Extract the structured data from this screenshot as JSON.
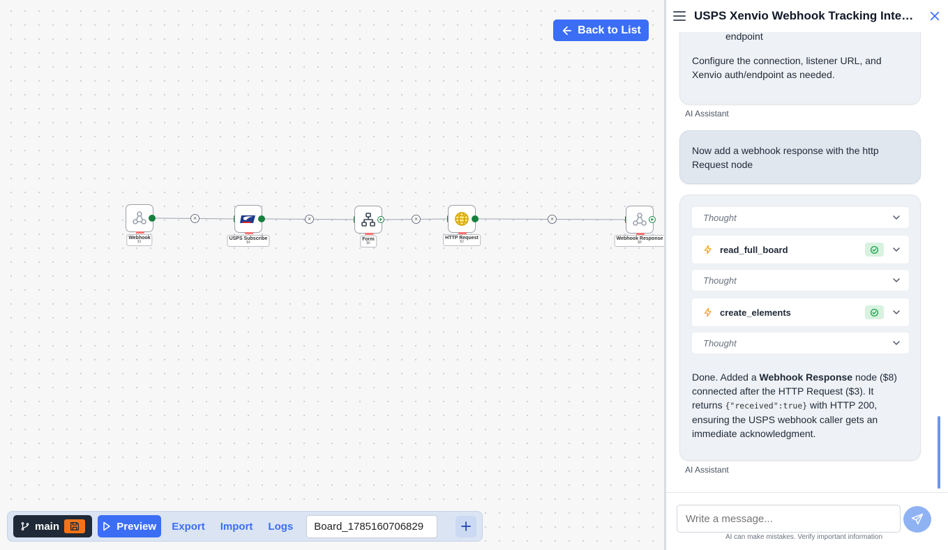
{
  "canvas": {
    "back_button": "Back to List",
    "nodes": [
      {
        "label": "Webhook",
        "id": "$1",
        "icon": "webhook-icon"
      },
      {
        "label": "USPS Subscribe",
        "id": "$4",
        "icon": "usps-eagle-icon"
      },
      {
        "label": "Form",
        "id": "$6",
        "icon": "sitemap-icon"
      },
      {
        "label": "HTTP Request",
        "id": "$3",
        "icon": "globe-icon"
      },
      {
        "label": "Webhook Response",
        "id": "$8",
        "icon": "webhook-icon"
      }
    ]
  },
  "toolbar": {
    "branch": "main",
    "preview": "Preview",
    "export": "Export",
    "import": "Import",
    "logs": "Logs",
    "board_name": "Board_1785160706829"
  },
  "panel": {
    "title": "USPS Xenvio Webhook Tracking Integr...",
    "msg1": {
      "line_top": "endpoint",
      "text": "Configure the connection, listener URL, and Xenvio auth/endpoint as needed.",
      "author": "AI Assistant"
    },
    "msg2": {
      "text": "Now add a webhook response with the http Request node"
    },
    "msg3": {
      "tools": [
        {
          "kind": "thought",
          "label": "Thought"
        },
        {
          "kind": "tool",
          "label": "read_full_board"
        },
        {
          "kind": "thought",
          "label": "Thought"
        },
        {
          "kind": "tool",
          "label": "create_elements"
        },
        {
          "kind": "thought",
          "label": "Thought"
        }
      ],
      "done_prefix": "Done. Added a ",
      "done_bold": "Webhook Response",
      "done_mid": " node ($8) connected after the HTTP Request ($3). It returns ",
      "done_code": "{\"received\":true}",
      "done_suffix": " with HTTP 200, ensuring the USPS webhook caller gets an immediate acknowledgment.",
      "author": "AI Assistant"
    },
    "composer": {
      "placeholder": "Write a message...",
      "disclaimer": "AI can make mistakes. Verify important information"
    }
  },
  "colors": {
    "accent": "#3b6ef5",
    "port": "#15803d",
    "save": "#f97316"
  }
}
